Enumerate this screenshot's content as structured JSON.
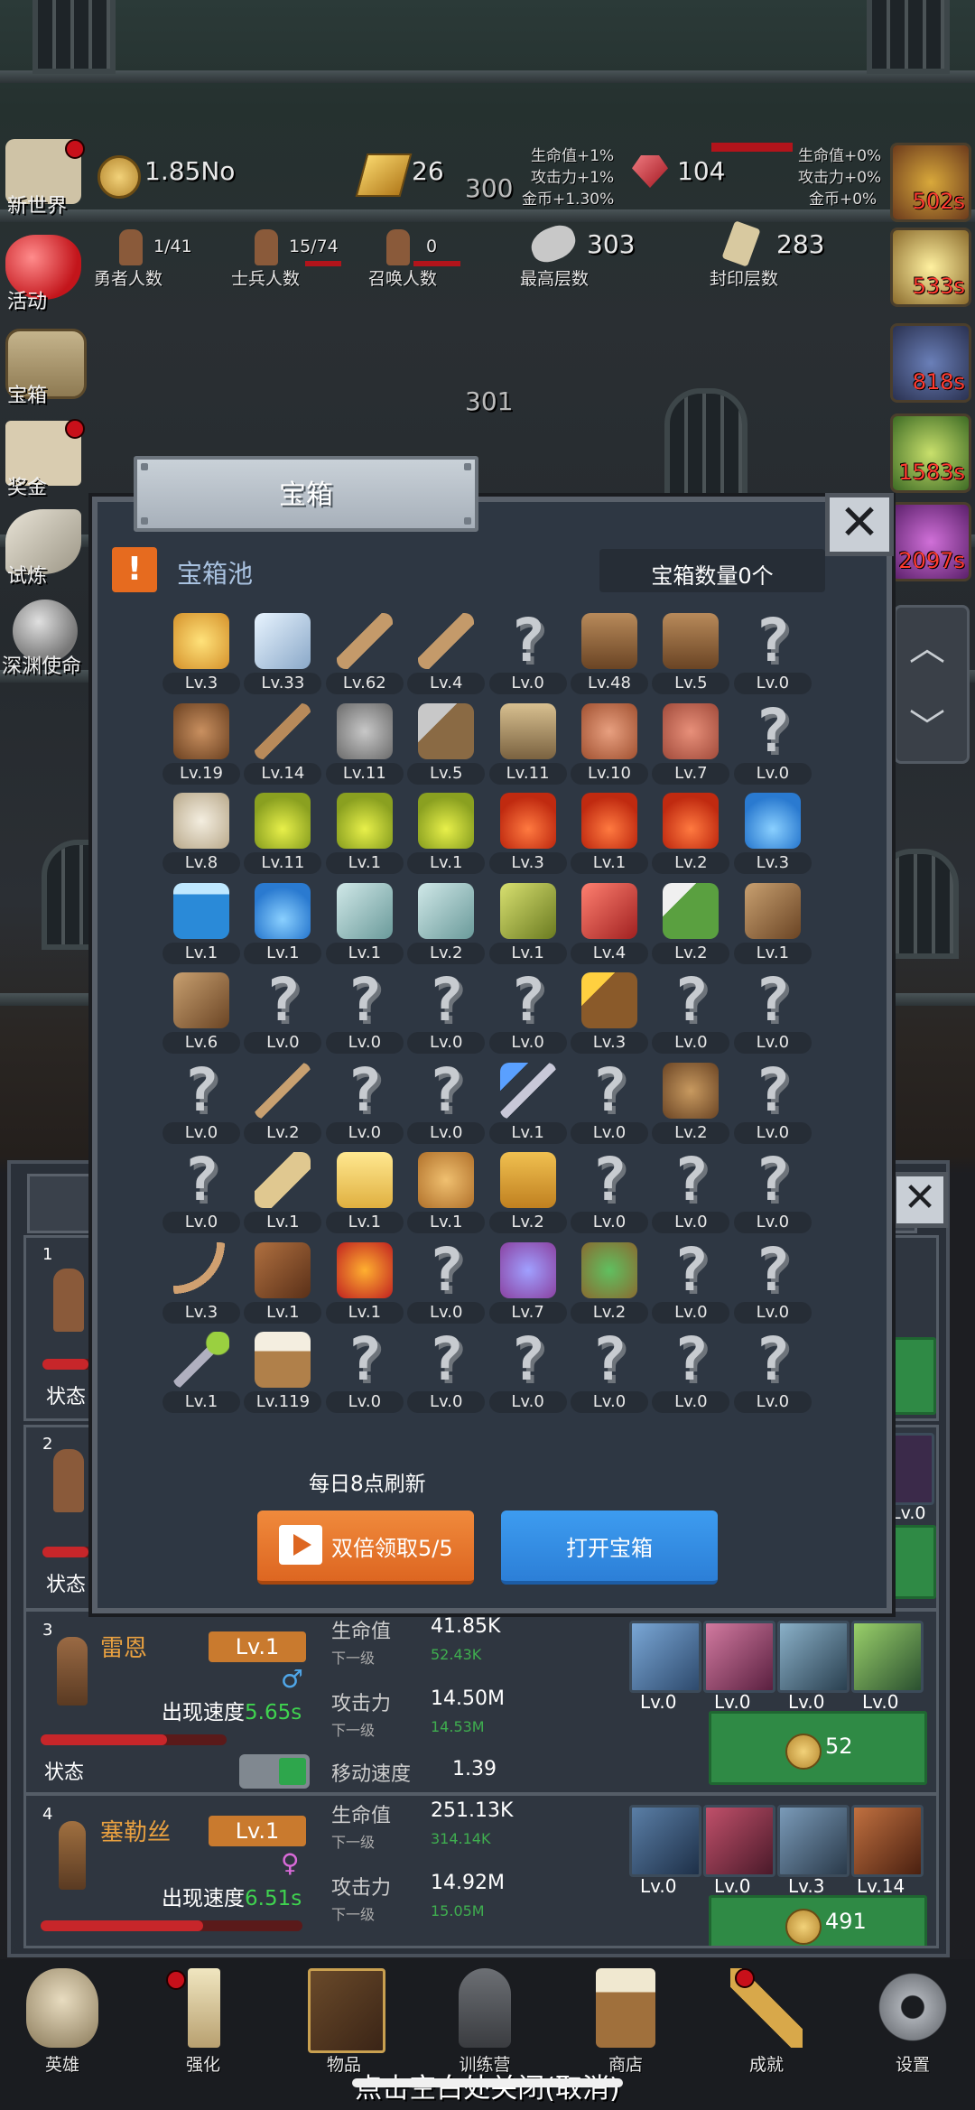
{
  "hud": {
    "coins": "1.85No",
    "gold_bars": "26",
    "gems": "104",
    "floor_top": "300",
    "floor_mid": "301",
    "bonus_left": [
      "生命值+1%",
      "攻击力+1%",
      "金币+1.30%"
    ],
    "bonus_right": [
      "生命值+0%",
      "攻击力+0%",
      "金币+0%"
    ],
    "heroes_count": "1/41",
    "heroes_label": "勇者人数",
    "soldiers_count": "15/74",
    "soldiers_label": "士兵人数",
    "summon_count": "0",
    "summon_label": "召唤人数",
    "max_floor": "303",
    "max_floor_label": "最高层数",
    "seal_floor": "283",
    "seal_floor_label": "封印层数"
  },
  "left_menu": [
    {
      "label": "新世界",
      "icon": "map-scroll-icon",
      "dot": true
    },
    {
      "label": "活动",
      "icon": "heart-icon",
      "dot": false
    },
    {
      "label": "宝箱",
      "icon": "treasure-chest-icon",
      "dot": false
    },
    {
      "label": "奖金",
      "icon": "envelope-icon",
      "dot": true
    },
    {
      "label": "试炼",
      "icon": "feather-icon",
      "dot": false
    },
    {
      "label": "深渊使命",
      "icon": "orb-icon",
      "dot": false
    }
  ],
  "timers": [
    "502s",
    "533s",
    "818s",
    "1583s",
    "2097s"
  ],
  "modal": {
    "title": "宝箱",
    "pool_label": "宝箱池",
    "count_label": "宝箱数量0个",
    "refresh_note": "每日8点刷新",
    "double_label": "双倍领取5/5",
    "open_label": "打开宝箱",
    "items": [
      [
        "Lv.3",
        "Lv.33",
        "Lv.62",
        "Lv.4",
        "Lv.0",
        "Lv.48",
        "Lv.5",
        "Lv.0"
      ],
      [
        "Lv.19",
        "Lv.14",
        "Lv.11",
        "Lv.5",
        "Lv.11",
        "Lv.10",
        "Lv.7",
        "Lv.0"
      ],
      [
        "Lv.8",
        "Lv.11",
        "Lv.1",
        "Lv.1",
        "Lv.3",
        "Lv.1",
        "Lv.2",
        "Lv.3"
      ],
      [
        "Lv.1",
        "Lv.1",
        "Lv.1",
        "Lv.2",
        "Lv.1",
        "Lv.4",
        "Lv.2",
        "Lv.1"
      ],
      [
        "Lv.6",
        "Lv.0",
        "Lv.0",
        "Lv.0",
        "Lv.0",
        "Lv.3",
        "Lv.0",
        "Lv.0"
      ],
      [
        "Lv.0",
        "Lv.2",
        "Lv.0",
        "Lv.0",
        "Lv.1",
        "Lv.0",
        "Lv.2",
        "Lv.0"
      ],
      [
        "Lv.0",
        "Lv.1",
        "Lv.1",
        "Lv.1",
        "Lv.2",
        "Lv.0",
        "Lv.0",
        "Lv.0"
      ],
      [
        "Lv.3",
        "Lv.1",
        "Lv.1",
        "Lv.0",
        "Lv.7",
        "Lv.2",
        "Lv.0",
        "Lv.0"
      ],
      [
        "Lv.1",
        "Lv.119",
        "Lv.0",
        "Lv.0",
        "Lv.0",
        "Lv.0",
        "Lv.0",
        "Lv.0"
      ]
    ],
    "icons": [
      [
        "crown",
        "diamond",
        "sword",
        "sword",
        "unknown",
        "armor",
        "armor",
        "unknown"
      ],
      [
        "helmet",
        "dagger",
        "knight-helmet",
        "hammer",
        "great-helm",
        "ham",
        "steak",
        "unknown"
      ],
      [
        "bread",
        "potion-yellow",
        "potion-yellow",
        "potion-yellow",
        "potion-red",
        "potion-red",
        "potion-red",
        "potion-blue"
      ],
      [
        "jar-blue",
        "potion-blue",
        "vial",
        "vial",
        "bottle",
        "bottle-red",
        "winged-boot",
        "boot"
      ],
      [
        "boot",
        "unknown",
        "unknown",
        "unknown",
        "unknown",
        "torch",
        "unknown",
        "unknown"
      ],
      [
        "unknown",
        "staff",
        "unknown",
        "unknown",
        "wand",
        "unknown",
        "backpack",
        "unknown"
      ],
      [
        "unknown",
        "club",
        "cheese",
        "pie",
        "honey-jar",
        "unknown",
        "unknown",
        "unknown"
      ],
      [
        "bow",
        "quiver",
        "shield-red",
        "unknown",
        "amulet",
        "shield-green",
        "unknown",
        "unknown"
      ],
      [
        "scepter",
        "beer-mug",
        "unknown",
        "unknown",
        "unknown",
        "unknown",
        "unknown",
        "unknown"
      ]
    ]
  },
  "heroes": [
    {
      "index": "1",
      "status": "状态"
    },
    {
      "index": "2",
      "status": "状态",
      "skill_lv": "Lv.0"
    },
    {
      "index": "3",
      "name": "雷恩",
      "level": "Lv.1",
      "spawn_label": "出现速度",
      "spawn": "5.65s",
      "hp_label": "生命值",
      "hp": "41.85K",
      "next_label": "下一级",
      "hp_next": "52.43K",
      "atk_label": "攻击力",
      "atk": "14.50M",
      "atk_next": "14.53M",
      "move_label": "移动速度",
      "move": "1.39",
      "status": "状态",
      "skills": [
        "Lv.0",
        "Lv.0",
        "Lv.0",
        "Lv.0"
      ],
      "upgrade_cost": "52"
    },
    {
      "index": "4",
      "name": "塞勒丝",
      "level": "Lv.1",
      "spawn_label": "出现速度",
      "spawn": "6.51s",
      "hp_label": "生命值",
      "hp": "251.13K",
      "next_label": "下一级",
      "hp_next": "314.14K",
      "atk_label": "攻击力",
      "atk": "14.92M",
      "atk_next": "15.05M",
      "skills": [
        "Lv.0",
        "Lv.0",
        "Lv.3",
        "Lv.14"
      ],
      "upgrade_cost": "491"
    }
  ],
  "bottom_nav": [
    {
      "label": "英雄",
      "icon": "skull-icon",
      "dot": false
    },
    {
      "label": "强化",
      "icon": "candle-icon",
      "dot": true
    },
    {
      "label": "物品",
      "icon": "book-icon",
      "dot": false
    },
    {
      "label": "训练营",
      "icon": "lantern-icon",
      "dot": false
    },
    {
      "label": "商店",
      "icon": "mug-icon",
      "dot": false
    },
    {
      "label": "成就",
      "icon": "key-icon",
      "dot": true
    },
    {
      "label": "设置",
      "icon": "gear-icon",
      "dot": false
    }
  ],
  "dismiss_hint": "点击空白处关闭(取消)",
  "colors": {
    "accent_orange": "#dd6621",
    "accent_blue": "#2c7fd7",
    "timer_red": "#ff3b30",
    "next_green": "#3fae4f"
  }
}
